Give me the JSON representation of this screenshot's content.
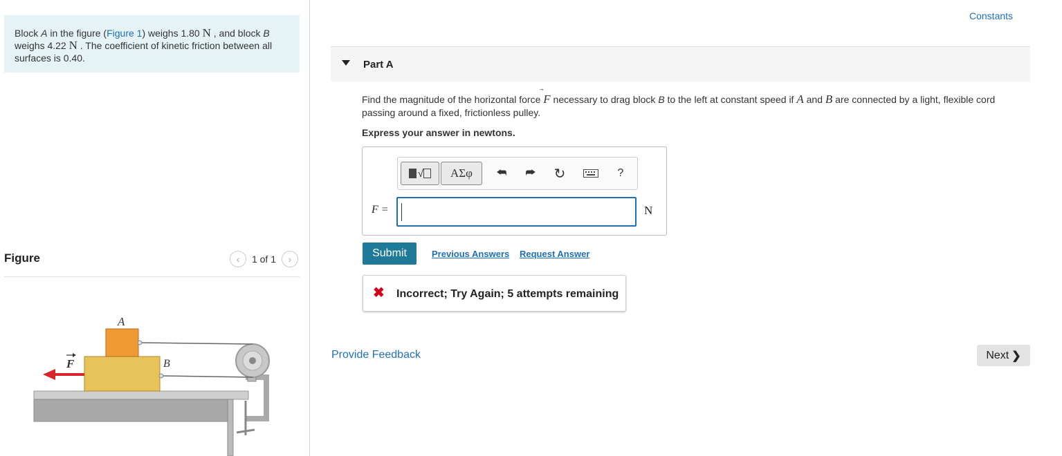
{
  "problem": {
    "text_before_a": "Block ",
    "block_a": "A",
    "text_in_fig": " in the figure (",
    "figure_link": "Figure 1",
    "text_weighs": ") weighs 1.80 ",
    "unit_n1": "N",
    "text_and_block": " , and block ",
    "block_b": "B",
    "text_weighs2": "weighs 4.22 ",
    "unit_n2": "N",
    "text_coeff": " . The coefficient of kinetic friction between all surfaces is 0.40."
  },
  "figure_panel": {
    "title": "Figure",
    "counter": "1 of 1",
    "labels": {
      "a": "A",
      "b": "B",
      "f": "F"
    }
  },
  "header": {
    "constants": "Constants"
  },
  "part": {
    "title": "Part A",
    "question_1": "Find the magnitude of the horizontal force ",
    "question_f": "F",
    "question_2": " necessary to drag block ",
    "question_b": "B",
    "question_3": " to the left at constant speed if ",
    "question_a2": "A",
    "question_and": " and ",
    "question_b2": "B",
    "question_4": " are connected by a light, flexible cord passing around a fixed, frictionless pulley.",
    "express": "Express your answer in newtons."
  },
  "answer": {
    "toolbar": {
      "greek_label": "ΑΣφ",
      "help_label": "?"
    },
    "label": "F =",
    "value": "",
    "unit": "N"
  },
  "actions": {
    "submit": "Submit",
    "previous_answers": "Previous Answers",
    "request_answer": "Request Answer"
  },
  "feedback": {
    "message": "Incorrect; Try Again; 5 attempts remaining"
  },
  "footer": {
    "provide_feedback": "Provide Feedback",
    "next": "Next"
  }
}
